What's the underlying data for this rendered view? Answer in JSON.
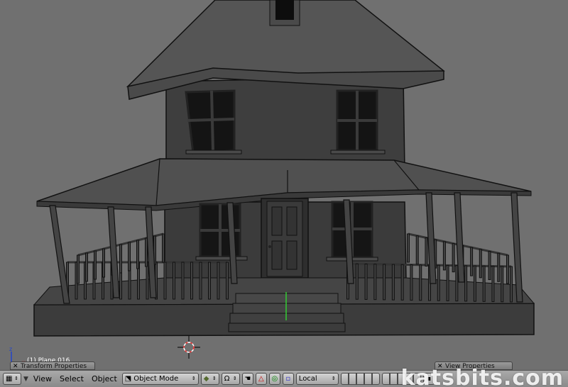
{
  "viewport": {
    "object_info": "(1) Plane.016",
    "panel_transform_title": "Transform Properties",
    "panel_view_title": "View Properties",
    "watermark": "katsbits.com",
    "colors": {
      "background": "#707070",
      "house": "#3f3f3f",
      "edge": "#111111",
      "axis_green": "#33cc33"
    }
  },
  "toolbar": {
    "menus": [
      "View",
      "Select",
      "Object"
    ],
    "mode_label": "Object Mode",
    "orientation_label": "Local",
    "icons": [
      "editor-type-grid-icon",
      "collapse-arrow-icon",
      "object-mode-icon",
      "draw-type-cube-icon",
      "pivot-icon",
      "hand-manipulator-icon",
      "translate-icon",
      "rotate-icon",
      "scale-icon"
    ]
  }
}
